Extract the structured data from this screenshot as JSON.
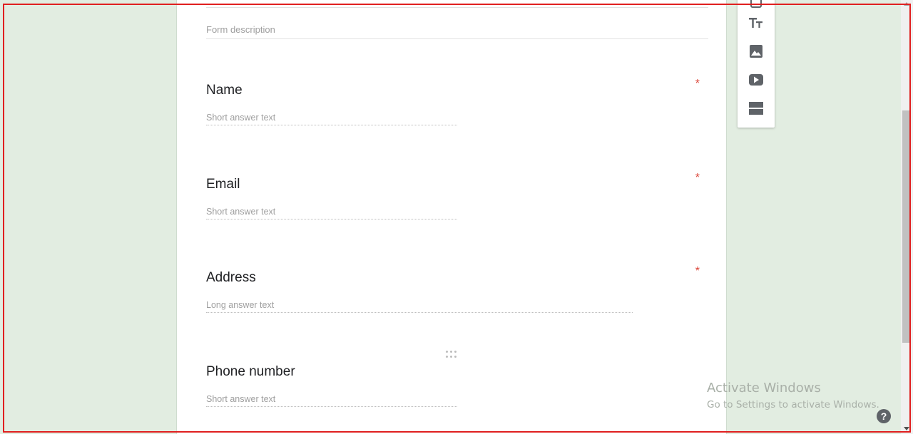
{
  "form": {
    "description_placeholder": "Form description",
    "questions": [
      {
        "title": "Name",
        "required_mark": "*",
        "answer_placeholder": "Short answer text"
      },
      {
        "title": "Email",
        "required_mark": "*",
        "answer_placeholder": "Short answer text"
      },
      {
        "title": "Address",
        "required_mark": "*",
        "answer_placeholder": "Long answer text"
      },
      {
        "title": "Phone number",
        "answer_placeholder": "Short answer text"
      }
    ]
  },
  "toolbar": {
    "items": [
      "import-questions-icon",
      "add-title-description-icon",
      "add-image-icon",
      "add-video-icon",
      "add-section-icon"
    ]
  },
  "watermark": {
    "line1": "Activate Windows",
    "line2": "Go to Settings to activate Windows."
  },
  "help": {
    "label": "?"
  },
  "colors": {
    "background": "#e2ede1",
    "required": "#db4437",
    "icon": "#5f6368",
    "highlight_frame": "#e01f1f"
  }
}
